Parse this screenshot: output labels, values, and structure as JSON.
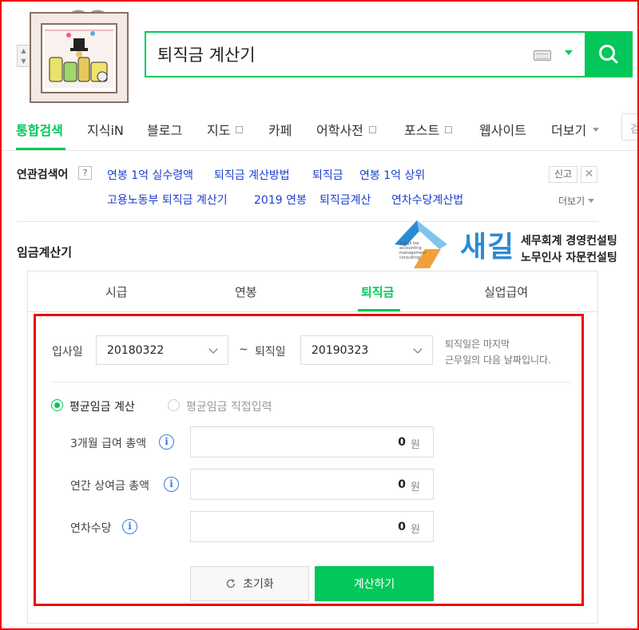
{
  "search": {
    "query": "퇴직금 계산기"
  },
  "nav": {
    "items": [
      {
        "label": "통합검색"
      },
      {
        "label": "지식iN"
      },
      {
        "label": "블로그"
      },
      {
        "label": "지도"
      },
      {
        "label": "카페"
      },
      {
        "label": "어학사전"
      },
      {
        "label": "포스트"
      },
      {
        "label": "웹사이트"
      },
      {
        "label": "더보기"
      }
    ],
    "search_stub": "검"
  },
  "related": {
    "title": "연관검색어",
    "help": "?",
    "links": [
      "연봉 1억 실수령액",
      "퇴직금 계산방법",
      "퇴직금",
      "연봉 1억 상위",
      "고용노동부 퇴직금 계산기",
      "2019 연봉",
      "퇴직금계산",
      "연차수당계산법"
    ],
    "report": "신고",
    "close": "✕",
    "more": "더보기"
  },
  "brand": {
    "name": "새길",
    "line1": "세무회계 경영컨설팅",
    "line2": "노무인사 자문컨설팅",
    "small": "Saegil tax accounting management consulting"
  },
  "calculator": {
    "title": "임금계산기",
    "tabs": [
      "시급",
      "연봉",
      "퇴직금",
      "실업급여"
    ],
    "active_tab": "퇴직금",
    "start_label": "입사일",
    "start_value": "20180322",
    "tilde": "~",
    "end_label": "퇴직일",
    "end_value": "20190323",
    "note_line1": "퇴직일은 마지막",
    "note_line2": "근무일의 다음 날짜입니다.",
    "radio_avg_calc": "평균임금 계산",
    "radio_avg_direct": "평균임금 직접입력",
    "fields": [
      {
        "label": "3개월 급여 총액",
        "value": "0",
        "unit": "원"
      },
      {
        "label": "연간 상여금 총액",
        "value": "0",
        "unit": "원"
      },
      {
        "label": "연차수당",
        "value": "0",
        "unit": "원"
      }
    ],
    "info": "i",
    "reset_label": "초기화",
    "calc_label": "계산하기"
  },
  "colors": {
    "accent": "#03c75a",
    "link": "#1a3ed3",
    "highlight": "#ee0000",
    "brand": "#2a8bd5"
  }
}
